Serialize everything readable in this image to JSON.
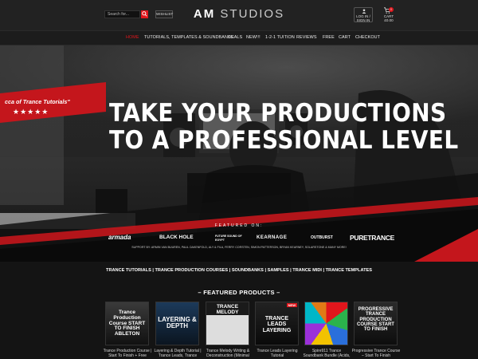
{
  "header": {
    "search_placeholder": "Search for...",
    "wishlist_label": "WISHLIST",
    "logo_am": "AM",
    "logo_studios": "STUDIOS",
    "login_line1": "LOG IN /",
    "login_line2": "SIGN IN",
    "cart_label": "CART",
    "cart_total": "£0.00",
    "cart_count": "0"
  },
  "nav": {
    "items": [
      "HOME",
      "TUTORIALS, TEMPLATES & SOUNDBANKS",
      "DEALS",
      "NEW!!!",
      "1-2-1 TUITION",
      "REVIEWS",
      "FREE",
      "CART",
      "CHECKOUT"
    ],
    "active": "HOME"
  },
  "hero": {
    "quote": "cca of Trance Tutorials\"",
    "stars": "★★★★★",
    "headline_line1": "TAKE YOUR PRODUCTIONS",
    "headline_line2": "TO A PROFESSIONAL LEVEL",
    "featured_on": "FEATURED ON:",
    "logos": [
      "armada",
      "BLACK HOLE",
      "FUTURE SOUND OF EGYPT",
      "KEARNAGE",
      "OUTBURST",
      "PURETRANCE"
    ],
    "support_text": "SUPPORT BY: ARMIN VAN BUUREN, PAUL OAKENFOLD, ALY & FILA, FERRY CORSTEN, SIMON PATTERSON, BRYAN KEARNEY, SOLARSTONE & MANY MORE!"
  },
  "categories": "TRANCE TUTORIALS | TRANCE PRODUCTION COURSES | SOUNDBANKS | SAMPLES | TRANCE MIDI | TRANCE TEMPLATES",
  "featured": {
    "title": "– FEATURED PRODUCTS –",
    "products": [
      {
        "name": "Trance Production Course | Start To Finish + Free",
        "cover": "Trance Production Course START TO FINISH ABLETON"
      },
      {
        "name": "Layering & Depth Tutorial | Trance Leads, Trance",
        "cover": "LAYERING & DEPTH"
      },
      {
        "name": "Trance Melody Writing & Deconstruction (Minimal",
        "cover": "TRANCE MELODY"
      },
      {
        "name": "Trance Leads Layering Tutorial",
        "cover": "TRANCE LEADS LAYERING"
      },
      {
        "name": "Spire911 Trance Soundbank Bundle (Acids,",
        "cover": ""
      },
      {
        "name": "Progressive Trance Course – Start To Finish",
        "cover": "PROGRESSIVE TRANCE PRODUCTION COURSE START TO FINISH"
      }
    ],
    "new_badge": "NEW"
  },
  "colors": {
    "accent": "#e0161c"
  }
}
